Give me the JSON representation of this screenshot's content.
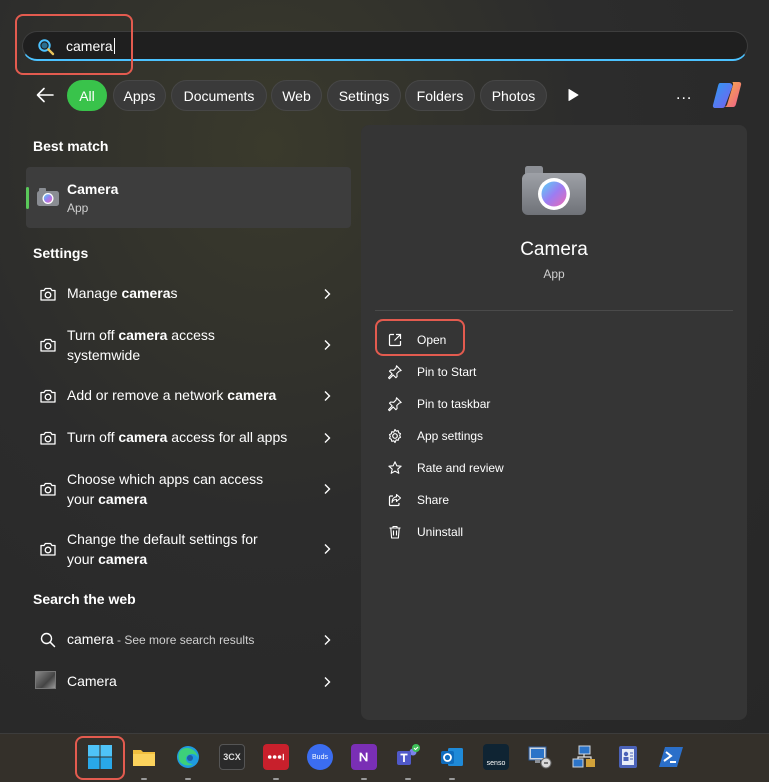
{
  "search": {
    "query": "camera"
  },
  "filters": [
    "All",
    "Apps",
    "Documents",
    "Web",
    "Settings",
    "Folders",
    "Photos"
  ],
  "more_label": "...",
  "best_match": {
    "heading": "Best match",
    "name": "Camera",
    "type": "App"
  },
  "settings_section": {
    "heading": "Settings",
    "items": [
      {
        "pre": "Manage ",
        "kw": "camera",
        "post": "s"
      },
      {
        "pre": "Turn off ",
        "kw": "camera",
        "post": " access systemwide"
      },
      {
        "pre": "Add or remove a network ",
        "kw": "camera",
        "post": ""
      },
      {
        "pre": "Turn off ",
        "kw": "camera",
        "post": " access for all apps"
      },
      {
        "pre": "Choose which apps can access your ",
        "kw": "camera",
        "post": ""
      },
      {
        "pre": "Change the default settings for your ",
        "kw": "camera",
        "post": ""
      }
    ]
  },
  "web_section": {
    "heading": "Search the web",
    "items": [
      {
        "label": "camera",
        "extra": " - See more search results"
      },
      {
        "label": "Camera",
        "extra": ""
      }
    ]
  },
  "detail": {
    "name": "Camera",
    "type": "App",
    "actions": [
      {
        "label": "Open",
        "icon": "open-external-icon"
      },
      {
        "label": "Pin to Start",
        "icon": "pin-icon"
      },
      {
        "label": "Pin to taskbar",
        "icon": "pin-icon"
      },
      {
        "label": "App settings",
        "icon": "gear-icon"
      },
      {
        "label": "Rate and review",
        "icon": "star-icon"
      },
      {
        "label": "Share",
        "icon": "share-icon"
      },
      {
        "label": "Uninstall",
        "icon": "trash-icon"
      }
    ]
  },
  "taskbar": {
    "items": [
      {
        "name": "start",
        "icon": "windows-start-icon",
        "running": false
      },
      {
        "name": "file-explorer",
        "icon": "folder-icon",
        "running": true
      },
      {
        "name": "edge",
        "icon": "edge-icon",
        "running": true
      },
      {
        "name": "3cx",
        "icon": "3cx-icon",
        "label": "3CX",
        "running": false
      },
      {
        "name": "lastpass",
        "icon": "lastpass-icon",
        "running": true
      },
      {
        "name": "buds",
        "icon": "buds-icon",
        "label": "Buds",
        "running": false
      },
      {
        "name": "onenote",
        "icon": "onenote-icon",
        "running": true
      },
      {
        "name": "teams",
        "icon": "teams-icon",
        "running": true
      },
      {
        "name": "outlook",
        "icon": "outlook-icon",
        "running": true
      },
      {
        "name": "senso",
        "icon": "senso-icon",
        "label": "senso",
        "running": false
      },
      {
        "name": "remote-desktop",
        "icon": "remote-desktop-icon",
        "running": false
      },
      {
        "name": "network-tool",
        "icon": "network-icon",
        "running": false
      },
      {
        "name": "directory-app",
        "icon": "directory-icon",
        "running": false
      },
      {
        "name": "powershell",
        "icon": "powershell-icon",
        "running": false
      }
    ]
  },
  "colors": {
    "accent_green": "#39c34b",
    "search_underline": "#4cc2ff",
    "annotation_red": "#e35b4f"
  }
}
